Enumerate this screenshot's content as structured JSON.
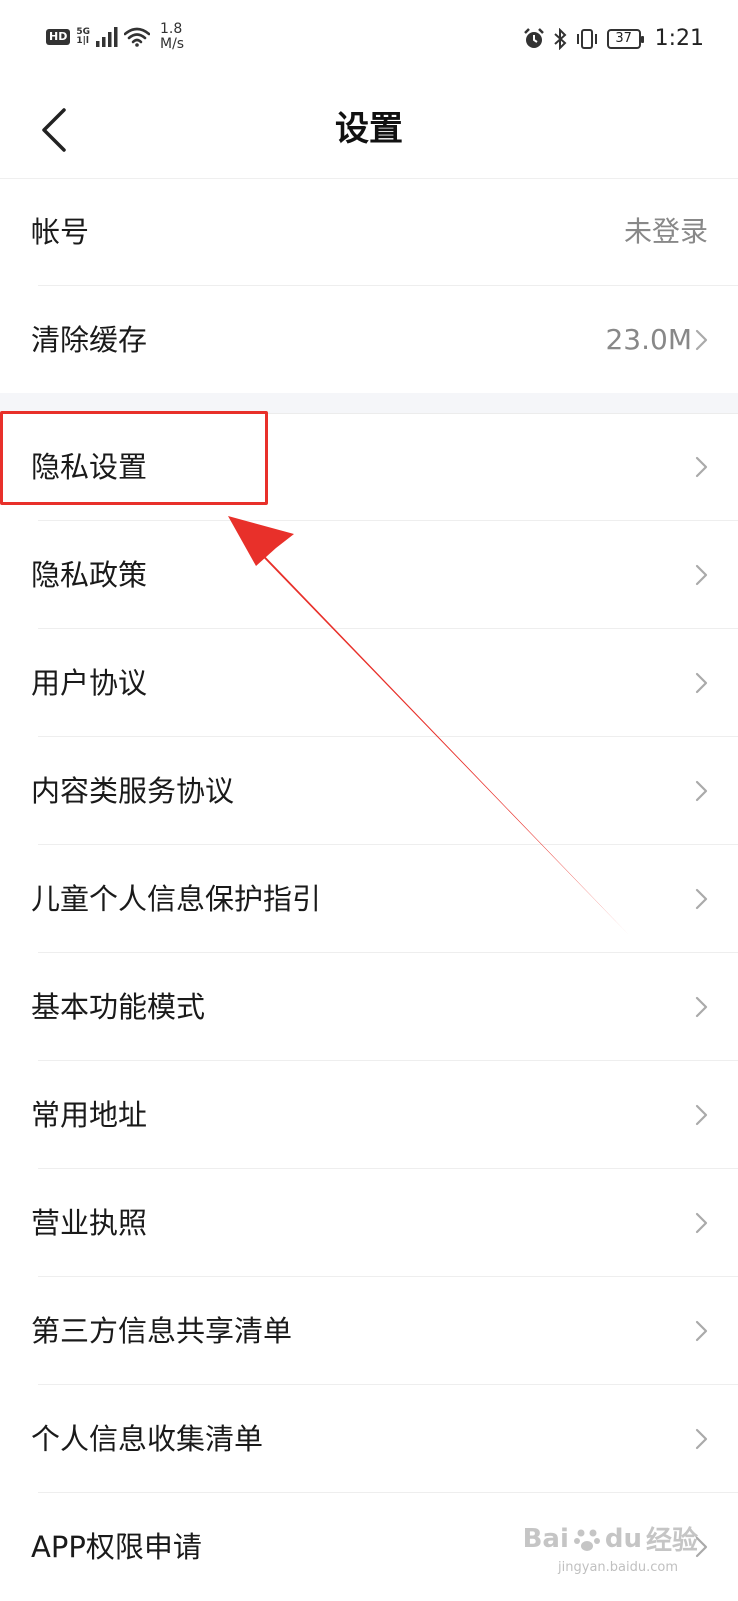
{
  "status_bar": {
    "hd": "HD",
    "network": "5G",
    "signal_sub": "1|l",
    "speed_value": "1.8",
    "speed_unit": "M/s",
    "battery": "37",
    "time": "1:21"
  },
  "nav": {
    "title": "设置"
  },
  "rows": [
    {
      "label": "帐号",
      "value": "未登录",
      "arrow": false
    },
    {
      "label": "清除缓存",
      "value": "23.0M",
      "arrow": true
    },
    {
      "label": "隐私设置",
      "value": "",
      "arrow": true
    },
    {
      "label": "隐私政策",
      "value": "",
      "arrow": true
    },
    {
      "label": "用户协议",
      "value": "",
      "arrow": true
    },
    {
      "label": "内容类服务协议",
      "value": "",
      "arrow": true
    },
    {
      "label": "儿童个人信息保护指引",
      "value": "",
      "arrow": true
    },
    {
      "label": "基本功能模式",
      "value": "",
      "arrow": true
    },
    {
      "label": "常用地址",
      "value": "",
      "arrow": true
    },
    {
      "label": "营业执照",
      "value": "",
      "arrow": true
    },
    {
      "label": "第三方信息共享清单",
      "value": "",
      "arrow": true
    },
    {
      "label": "个人信息收集清单",
      "value": "",
      "arrow": true
    },
    {
      "label": "APP权限申请",
      "value": "",
      "arrow": true
    }
  ],
  "annotation": {
    "color": "#e8302a"
  },
  "watermark": {
    "brand": "Bai",
    "brand2": "du",
    "cn": "经验",
    "url": "jingyan.baidu.com"
  }
}
